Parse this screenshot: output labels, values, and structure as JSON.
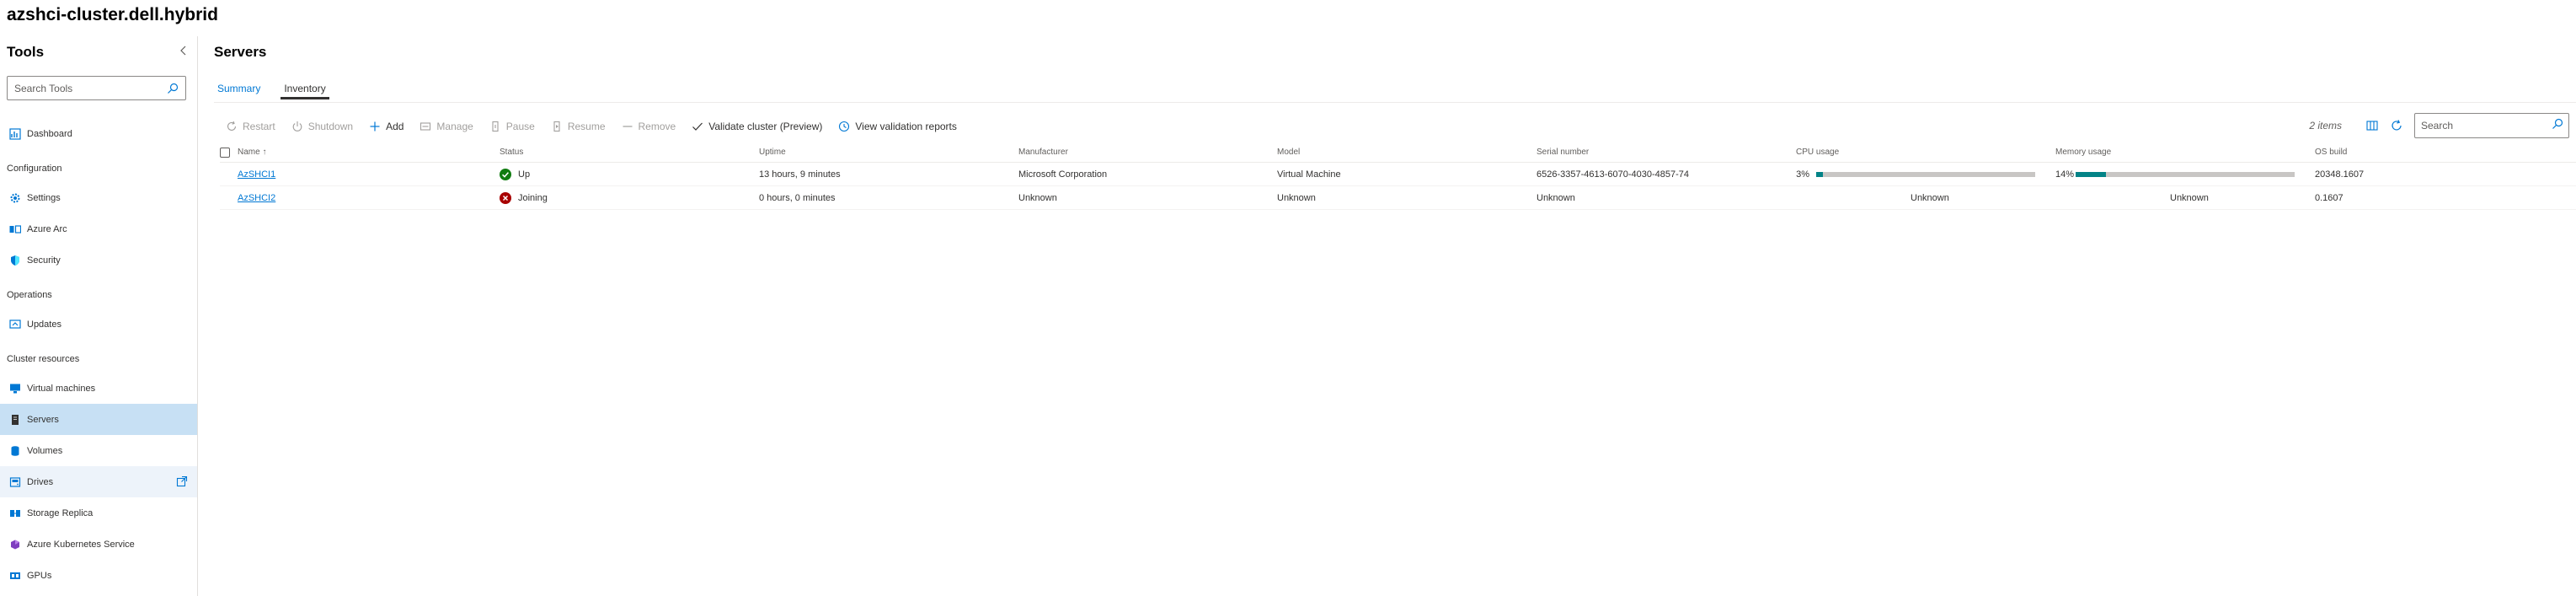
{
  "app": {
    "cluster_name": "azshci-cluster.dell.hybrid"
  },
  "sidebar": {
    "title": "Tools",
    "search_placeholder": "Search Tools",
    "items": [
      {
        "type": "item",
        "label": "Dashboard",
        "icon": "dashboard-icon"
      },
      {
        "type": "group",
        "label": "Configuration"
      },
      {
        "type": "item",
        "label": "Settings",
        "icon": "gear-icon"
      },
      {
        "type": "item",
        "label": "Azure Arc",
        "icon": "azure-arc-icon"
      },
      {
        "type": "item",
        "label": "Security",
        "icon": "shield-icon"
      },
      {
        "type": "group",
        "label": "Operations"
      },
      {
        "type": "item",
        "label": "Updates",
        "icon": "updates-icon"
      },
      {
        "type": "group",
        "label": "Cluster resources"
      },
      {
        "type": "item",
        "label": "Virtual machines",
        "icon": "monitor-icon"
      },
      {
        "type": "item",
        "label": "Servers",
        "icon": "server-icon",
        "selected": true
      },
      {
        "type": "item",
        "label": "Volumes",
        "icon": "volume-icon"
      },
      {
        "type": "item",
        "label": "Drives",
        "icon": "drive-icon",
        "hovered": true
      },
      {
        "type": "item",
        "label": "Storage Replica",
        "icon": "storage-replica-icon"
      },
      {
        "type": "item",
        "label": "Azure Kubernetes Service",
        "icon": "kubernetes-icon"
      },
      {
        "type": "item",
        "label": "GPUs",
        "icon": "gpu-icon"
      }
    ]
  },
  "main": {
    "title": "Servers",
    "tabs": [
      {
        "label": "Summary",
        "active": false
      },
      {
        "label": "Inventory",
        "active": true
      }
    ],
    "toolbar": {
      "restart": "Restart",
      "shutdown": "Shutdown",
      "add": "Add",
      "manage": "Manage",
      "pause": "Pause",
      "resume": "Resume",
      "remove": "Remove",
      "validate": "Validate cluster (Preview)",
      "view_reports": "View validation reports"
    },
    "item_count": "2 items",
    "search_placeholder": "Search"
  },
  "grid": {
    "columns": {
      "name": "Name ↑",
      "status": "Status",
      "uptime": "Uptime",
      "manufacturer": "Manufacturer",
      "model": "Model",
      "serial": "Serial number",
      "cpu": "CPU usage",
      "memory": "Memory usage",
      "os_build": "OS build"
    },
    "rows": [
      {
        "name": "AzSHCI1",
        "status": "Up",
        "status_color": "#107c10",
        "uptime": "13 hours, 9 minutes",
        "manufacturer": "Microsoft Corporation",
        "model": "Virtual Machine",
        "serial": "6526-3357-4613-6070-4030-4857-74",
        "cpu_pct": "3%",
        "cpu_value": 3,
        "memory_pct": "14%",
        "memory_value": 14,
        "os_build": "20348.1607"
      },
      {
        "name": "AzSHCI2",
        "status": "Joining",
        "status_color": "#a80000",
        "uptime": "0 hours, 0 minutes",
        "manufacturer": "Unknown",
        "model": "Unknown",
        "serial": "Unknown",
        "cpu_text": "Unknown",
        "memory_text": "Unknown",
        "os_build": "0.1607"
      }
    ]
  },
  "colors": {
    "accent": "#0078d4",
    "selected_nav": "#c7e0f4",
    "usage_fill": "#038387",
    "status_up": "#107c10",
    "status_error": "#a80000"
  }
}
